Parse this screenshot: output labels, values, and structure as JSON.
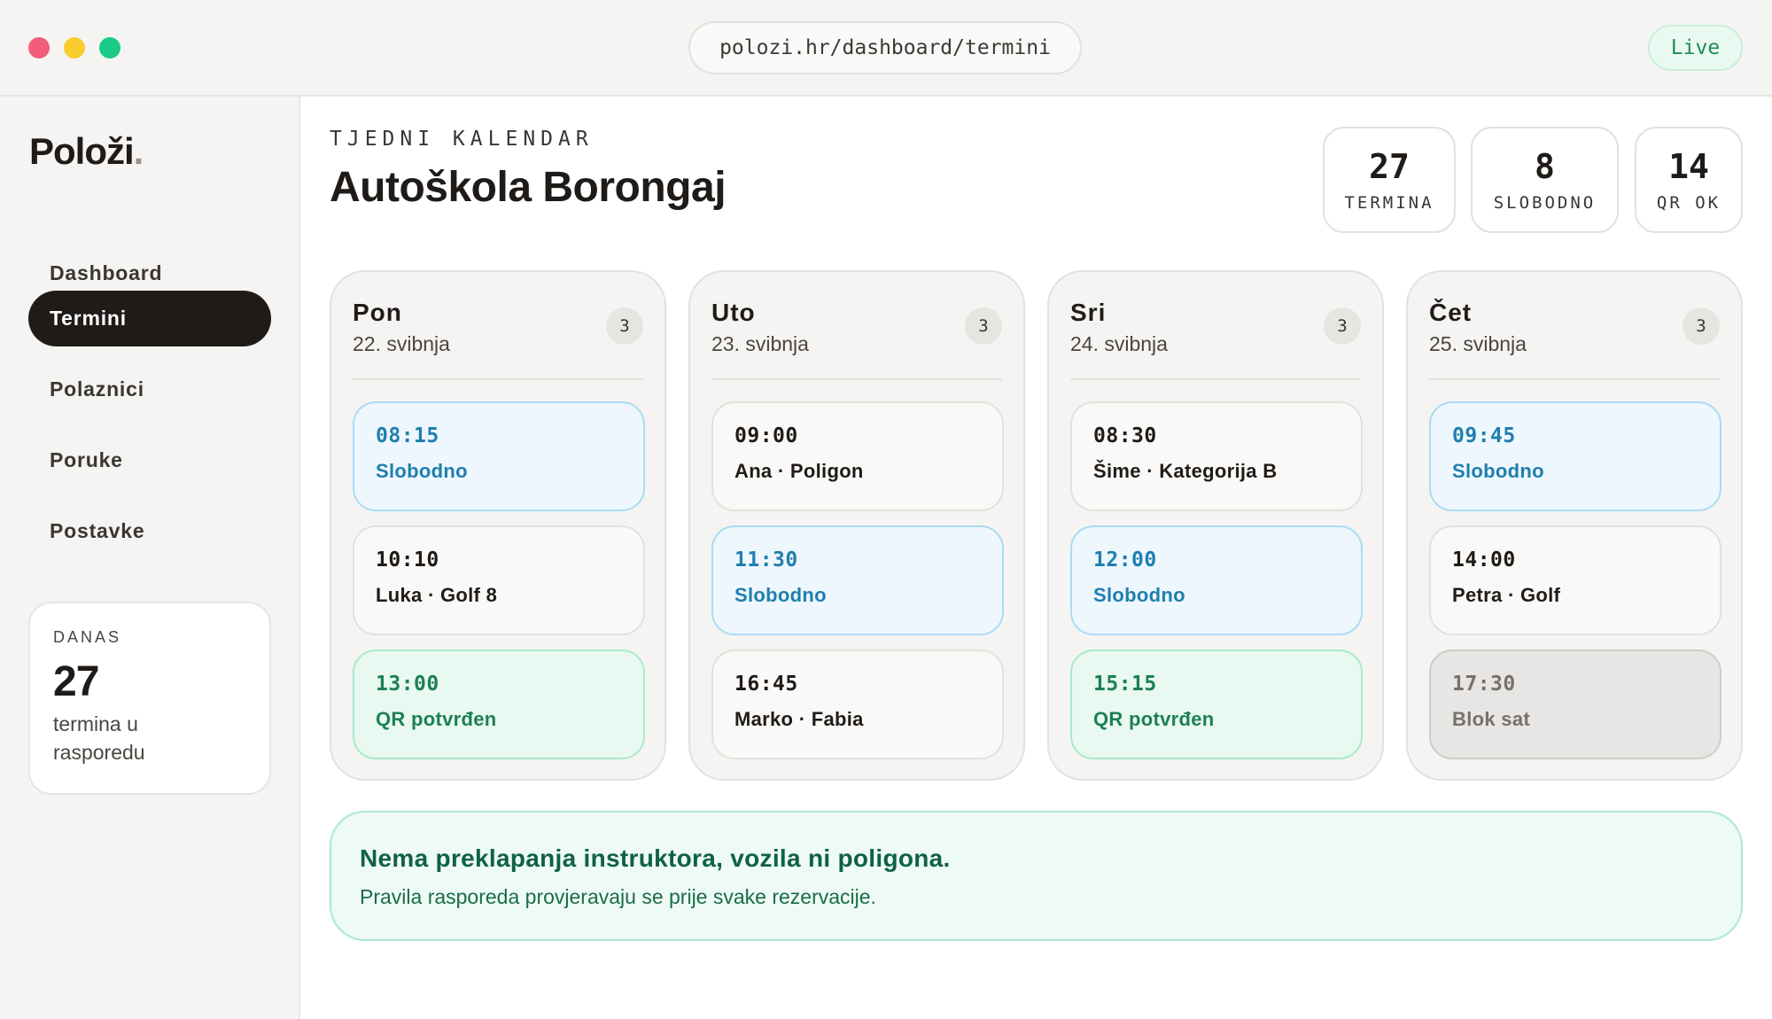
{
  "window": {
    "url": "polozi.hr/dashboard/termini",
    "live_label": "Live"
  },
  "sidebar": {
    "logo": "Položi",
    "logo_dot": ".",
    "items": [
      {
        "label": "Dashboard",
        "active": false
      },
      {
        "label": "Termini",
        "active": true
      },
      {
        "label": "Polaznici",
        "active": false
      },
      {
        "label": "Poruke",
        "active": false
      },
      {
        "label": "Postavke",
        "active": false
      }
    ],
    "today": {
      "label": "DANAS",
      "value": "27",
      "text": "termina u rasporedu"
    }
  },
  "header": {
    "kicker": "TJEDNI KALENDAR",
    "title": "Autoškola Borongaj"
  },
  "stats": [
    {
      "value": "27",
      "label": "TERMINA"
    },
    {
      "value": "8",
      "label": "SLOBODNO"
    },
    {
      "value": "14",
      "label": "QR OK"
    }
  ],
  "days": [
    {
      "name": "Pon",
      "date": "22. svibnja",
      "count": "3",
      "slots": [
        {
          "time": "08:15",
          "label": "Slobodno",
          "status": "free"
        },
        {
          "time": "10:10",
          "label": "Luka · Golf 8",
          "status": "booked"
        },
        {
          "time": "13:00",
          "label": "QR potvrđen",
          "status": "qr"
        }
      ]
    },
    {
      "name": "Uto",
      "date": "23. svibnja",
      "count": "3",
      "slots": [
        {
          "time": "09:00",
          "label": "Ana · Poligon",
          "status": "booked"
        },
        {
          "time": "11:30",
          "label": "Slobodno",
          "status": "free"
        },
        {
          "time": "16:45",
          "label": "Marko · Fabia",
          "status": "booked"
        }
      ]
    },
    {
      "name": "Sri",
      "date": "24. svibnja",
      "count": "3",
      "slots": [
        {
          "time": "08:30",
          "label": "Šime · Kategorija B",
          "status": "booked"
        },
        {
          "time": "12:00",
          "label": "Slobodno",
          "status": "free"
        },
        {
          "time": "15:15",
          "label": "QR potvrđen",
          "status": "qr"
        }
      ]
    },
    {
      "name": "Čet",
      "date": "25. svibnja",
      "count": "3",
      "slots": [
        {
          "time": "09:45",
          "label": "Slobodno",
          "status": "free"
        },
        {
          "time": "14:00",
          "label": "Petra · Golf",
          "status": "booked"
        },
        {
          "time": "17:30",
          "label": "Blok sat",
          "status": "blocked"
        }
      ]
    }
  ],
  "notice": {
    "title": "Nema preklapanja instruktora, vozila ni poligona.",
    "text": "Pravila rasporeda provjeravaju se prije svake rezervacije."
  },
  "colors": {
    "accent_dark": "#1f1b18",
    "free_blue": "#1f7fae",
    "qr_green": "#1d7f56",
    "traffic_red": "#f25d78",
    "traffic_yellow": "#f9cd2f",
    "traffic_green": "#19cc86"
  }
}
